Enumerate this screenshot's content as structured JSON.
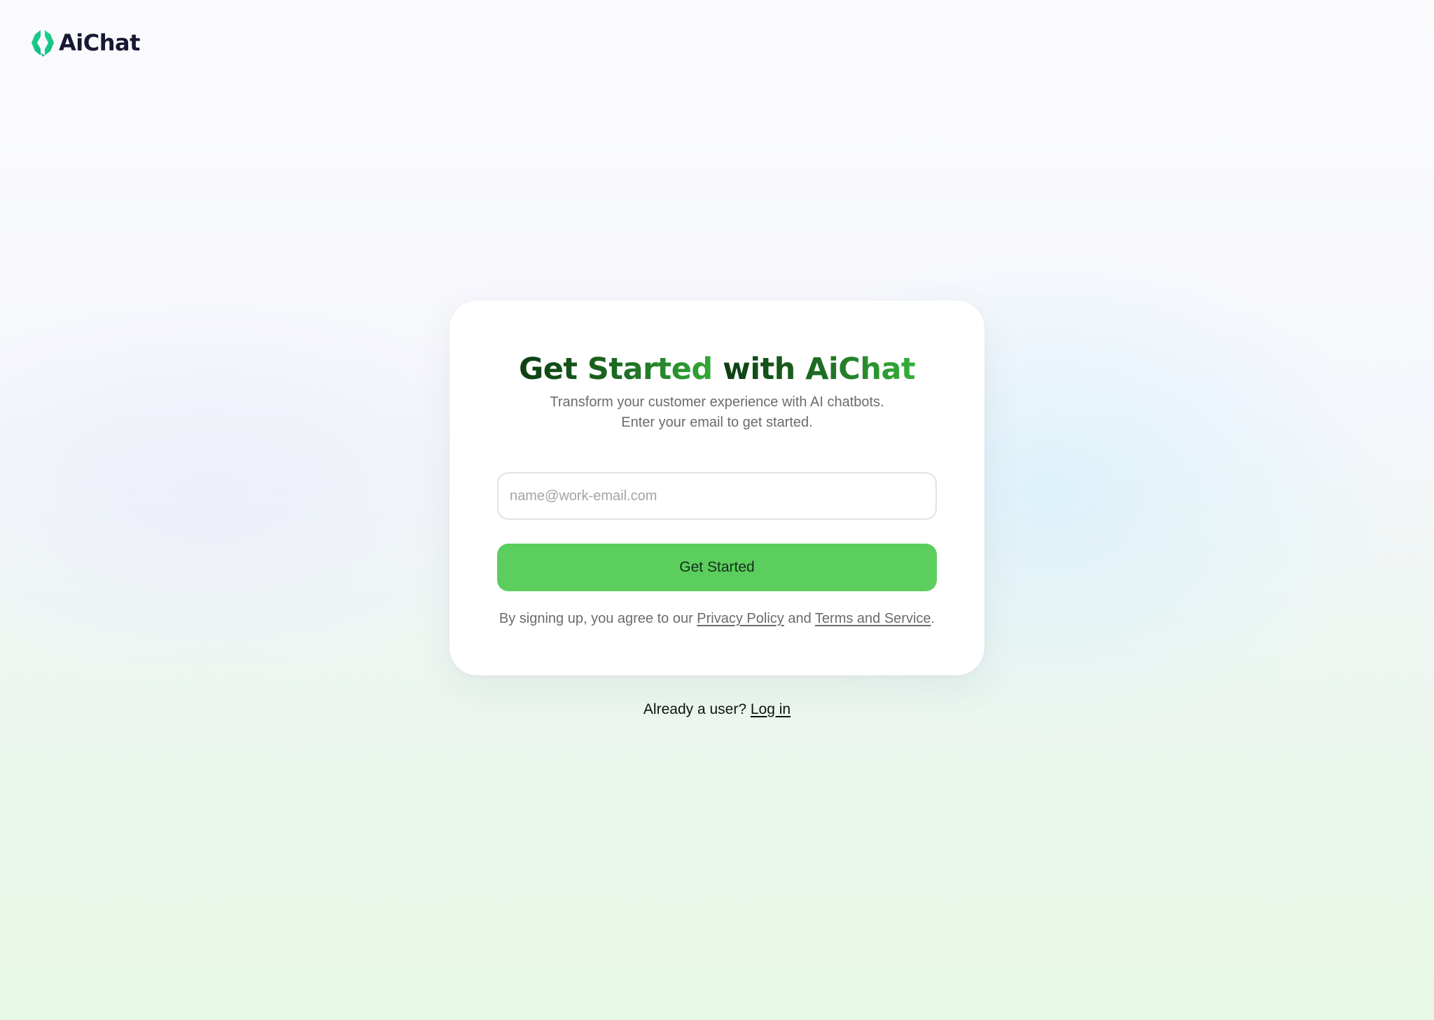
{
  "brand": {
    "name": "AiChat",
    "icon": "aichat-logo-icon",
    "accent_color": "#5bce5e",
    "logo_color": "#1fd58e"
  },
  "signup": {
    "title_part1": "Get Started ",
    "title_part2": "with AiChat",
    "subtitle_line1": "Transform your customer experience with AI chatbots.",
    "subtitle_line2": "Enter your email to get started.",
    "email_placeholder": "name@work-email.com",
    "email_value": "",
    "submit_label": "Get Started",
    "legal_prefix": "By signing up, you agree to our ",
    "privacy_link": "Privacy Policy",
    "legal_and": " and ",
    "terms_link": "Terms and Service",
    "legal_suffix": "."
  },
  "login_prompt": {
    "text": "Already a user? ",
    "link": "Log in"
  }
}
